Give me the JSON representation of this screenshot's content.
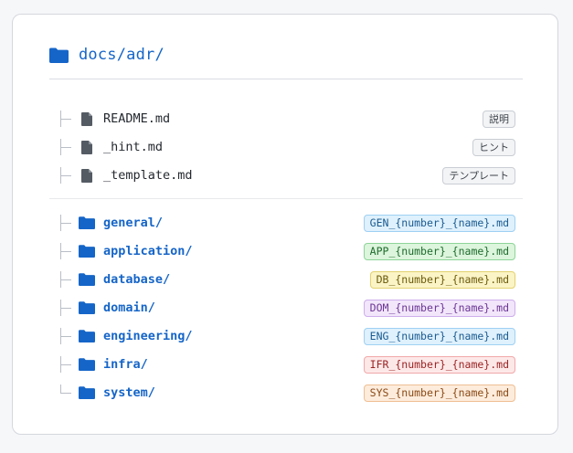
{
  "header": {
    "title": "docs/adr/",
    "icon": "folder-icon"
  },
  "files": [
    {
      "name": "README.md",
      "badge": "説明",
      "icon": "file-icon"
    },
    {
      "name": "_hint.md",
      "badge": "ヒント",
      "icon": "file-icon"
    },
    {
      "name": "_template.md",
      "badge": "テンプレート",
      "icon": "file-icon"
    }
  ],
  "folders": [
    {
      "name": "general/",
      "pattern": "GEN_{number}_{name}.md",
      "bg": "#dff1fd",
      "border": "#9fd0f3",
      "text": "#1a5a8f"
    },
    {
      "name": "application/",
      "pattern": "APP_{number}_{name}.md",
      "bg": "#dcf5dc",
      "border": "#8fd49a",
      "text": "#1f6b2d"
    },
    {
      "name": "database/",
      "pattern": "DB_{number}_{name}.md",
      "bg": "#fbf4c6",
      "border": "#e3d26f",
      "text": "#6b5a0c"
    },
    {
      "name": "domain/",
      "pattern": "DOM_{number}_{name}.md",
      "bg": "#f2e6fb",
      "border": "#cfaeec",
      "text": "#6b3593"
    },
    {
      "name": "engineering/",
      "pattern": "ENG_{number}_{name}.md",
      "bg": "#dff1fd",
      "border": "#9fd0f3",
      "text": "#1a5a8f"
    },
    {
      "name": "infra/",
      "pattern": "IFR_{number}_{name}.md",
      "bg": "#fde8e8",
      "border": "#f1a9a9",
      "text": "#9a2424"
    },
    {
      "name": "system/",
      "pattern": "SYS_{number}_{name}.md",
      "bg": "#fdecdc",
      "border": "#efbf93",
      "text": "#8a4a16"
    }
  ],
  "colors": {
    "accent": "#1565c8",
    "file_icon": "#555b63"
  }
}
